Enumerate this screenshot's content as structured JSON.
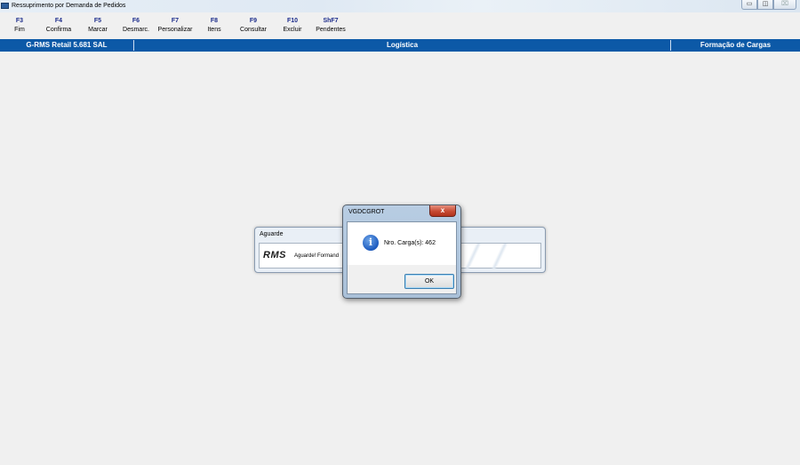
{
  "window": {
    "title": "Ressuprimento por Demanda de Pedidos",
    "buttons": {
      "minimize": "▭",
      "restore": "◫",
      "close": "⌧"
    }
  },
  "toolbar": {
    "keys": [
      {
        "key": "F3",
        "label": "Fim"
      },
      {
        "key": "F4",
        "label": "Confirma"
      },
      {
        "key": "F5",
        "label": "Marcar"
      },
      {
        "key": "F6",
        "label": "Desmarc."
      },
      {
        "key": "F7",
        "label": "Personalizar"
      },
      {
        "key": "F8",
        "label": "Itens"
      },
      {
        "key": "F9",
        "label": "Consultar"
      },
      {
        "key": "F10",
        "label": "Excluir"
      },
      {
        "key": "ShF7",
        "label": "Pendentes"
      }
    ]
  },
  "module_bar": {
    "system": "G-RMS Retail 5.681 SAL",
    "module": "Logística",
    "function": "Formação de Cargas",
    "color": "#0c59a7"
  },
  "aguarde": {
    "title": "Aguarde",
    "logo": "RMS",
    "message": "Aguarde! Formand"
  },
  "dialog": {
    "title": "VGDCGROT",
    "close_label": "x",
    "icon": "info-icon",
    "message": "Nro. Carga(s): 462",
    "ok_label": "OK"
  }
}
